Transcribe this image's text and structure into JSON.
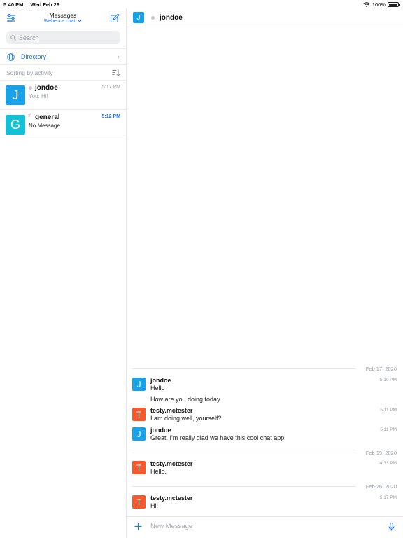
{
  "statusbar": {
    "time": "5:40 PM",
    "date": "Wed Feb 26",
    "battery": "100%"
  },
  "sidebar": {
    "title": "Messages",
    "server": "Webence.chat",
    "search_placeholder": "Search",
    "directory_label": "Directory",
    "sorting_label": "Sorting by activity",
    "rooms": [
      {
        "avatar": "J",
        "avatar_color": "#1aa2e8",
        "name": "jondoe",
        "time": "5:17 PM",
        "preview": "You: Hi!"
      },
      {
        "avatar": "G",
        "avatar_color": "#13c0d5",
        "name": "general",
        "time": "5:12 PM",
        "preview": "No Message"
      }
    ]
  },
  "chat": {
    "header": {
      "avatar": "J",
      "name": "jondoe"
    },
    "dates": [
      "Feb 17, 2020",
      "Feb 19, 2020",
      "Feb 26, 2020"
    ],
    "messages": [
      {
        "avatar": "J",
        "avatar_color": "#1aa2e8",
        "user": "jondoe",
        "time": "5:10 PM",
        "lines": [
          "Hello",
          "How are you doing today"
        ]
      },
      {
        "avatar": "T",
        "avatar_color": "#f5592e",
        "user": "testy.mctester",
        "time": "5:11 PM",
        "lines": [
          "I am doing well, yourself?"
        ]
      },
      {
        "avatar": "J",
        "avatar_color": "#1aa2e8",
        "user": "jondoe",
        "time": "5:11 PM",
        "lines": [
          "Great. I'm really glad we have this cool chat app"
        ]
      },
      {
        "avatar": "T",
        "avatar_color": "#f5592e",
        "user": "testy.mctester",
        "time": "4:33 PM",
        "lines": [
          "Hello."
        ]
      },
      {
        "avatar": "T",
        "avatar_color": "#f5592e",
        "user": "testy.mctester",
        "time": "5:17 PM",
        "lines": [
          "Hi!"
        ]
      }
    ],
    "composer_placeholder": "New Message"
  },
  "colors": {
    "accent": "#1d74f5",
    "muted": "#9aa0a6"
  }
}
